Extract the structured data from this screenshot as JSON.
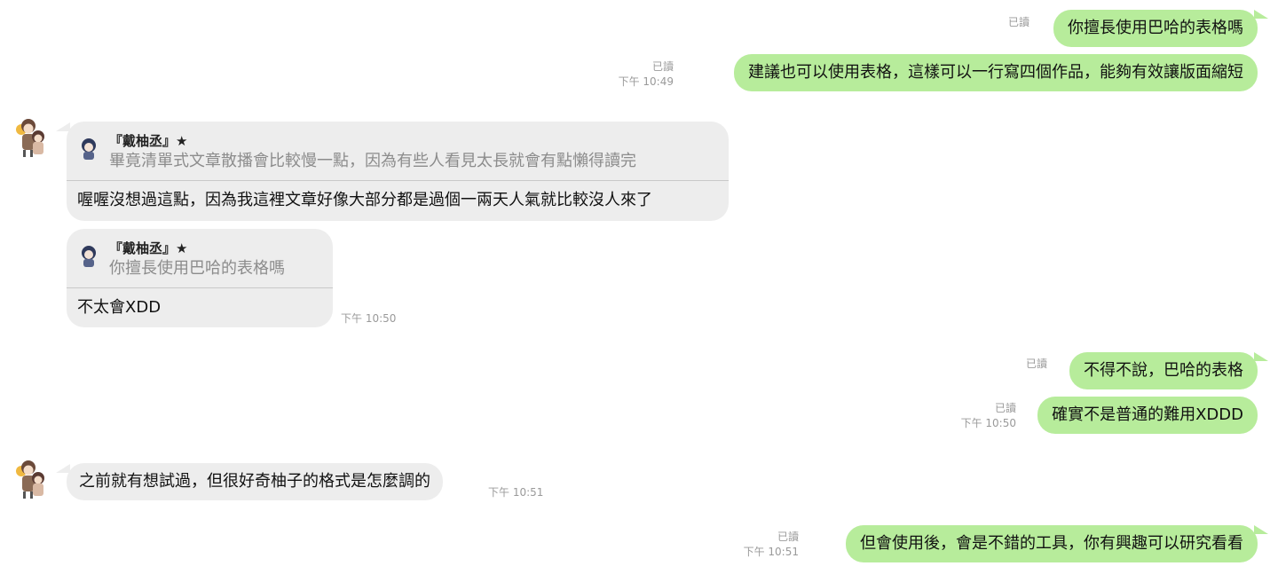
{
  "messages": {
    "m1": {
      "text": "你擅長使用巴哈的表格嗎",
      "read": "已讀",
      "time": ""
    },
    "m2": {
      "text": "建議也可以使用表格，這樣可以一行寫四個作品，能夠有效讓版面縮短",
      "read": "已讀",
      "time": "下午 10:49"
    },
    "m3": {
      "reply_name": "『戴柚丞』★",
      "reply_quote": "畢竟清單式文章散播會比較慢一點，因為有些人看見太長就會有點懶得讀完",
      "text": "喔喔沒想過這點，因為我這裡文章好像大部分都是過個一兩天人氣就比較沒人來了"
    },
    "m4": {
      "reply_name": "『戴柚丞』★",
      "reply_quote": "你擅長使用巴哈的表格嗎",
      "text": "不太會XDD",
      "time": "下午 10:50"
    },
    "m5": {
      "text": "不得不說，巴哈的表格",
      "read": "已讀"
    },
    "m6": {
      "text": "確實不是普通的難用XDDD",
      "read": "已讀",
      "time": "下午 10:50"
    },
    "m7": {
      "text": "之前就有想試過，但很好奇柚子的格式是怎麼調的",
      "time": "下午 10:51"
    },
    "m8": {
      "text": "但會使用後，會是不錯的工具，你有興趣可以研究看看",
      "read": "已讀",
      "time": "下午 10:51"
    }
  },
  "colors": {
    "outgoing": "#b7ec9b",
    "incoming": "#ededed",
    "meta": "#9a9a9a"
  }
}
